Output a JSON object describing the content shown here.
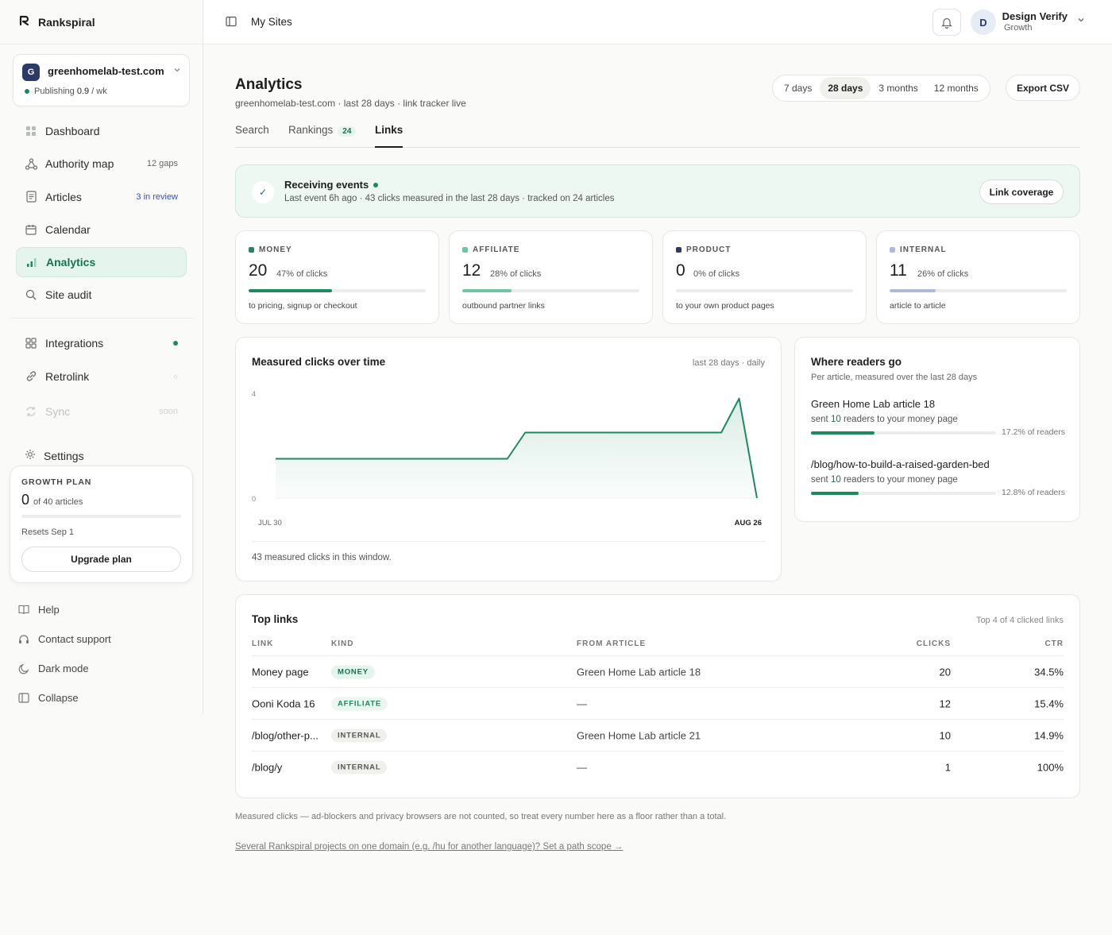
{
  "app": {
    "brand": "Rankspiral"
  },
  "site": {
    "avatar": "G",
    "name": "greenhomelab-test.com",
    "publishing_label": "Publishing",
    "publishing_rate": "0.9",
    "publishing_unit": "/ wk"
  },
  "nav": {
    "dashboard": "Dashboard",
    "authority": "Authority map",
    "authority_meta": "12 gaps",
    "articles": "Articles",
    "articles_meta": "3 in review",
    "calendar": "Calendar",
    "analytics": "Analytics",
    "audit": "Site audit",
    "integrations": "Integrations",
    "retrolink": "Retrolink",
    "retrolink_meta": "○",
    "sync": "Sync",
    "sync_meta": "soon",
    "settings": "Settings"
  },
  "plan": {
    "label": "GROWTH PLAN",
    "count": "0",
    "of": "of 40 articles",
    "used_fraction": 0,
    "resets": "Resets Sep 1",
    "button": "Upgrade plan"
  },
  "footer": {
    "help": "Help",
    "support": "Contact support",
    "dark": "Dark mode",
    "collapse": "Collapse"
  },
  "topbar": {
    "title": "My Sites",
    "user_initial": "D",
    "user_name": "Design Verify",
    "user_plan": "Growth"
  },
  "page": {
    "title": "Analytics",
    "subtitle": "greenhomelab-test.com · last 28 days · link tracker live"
  },
  "ranges": {
    "r7": "7 days",
    "r28": "28 days",
    "r3m": "3 months",
    "r12m": "12 months",
    "export": "Export CSV"
  },
  "tabs": {
    "search": "Search",
    "rankings": "Rankings",
    "rankings_count": "24",
    "links": "Links"
  },
  "events": {
    "title": "Receiving events",
    "subtitle": "Last event 6h ago · 43 clicks measured in the last 28 days · tracked on 24 articles",
    "button": "Link coverage"
  },
  "kpis": [
    {
      "label": "MONEY",
      "value": "20",
      "pct": "47% of clicks",
      "desc": "to pricing, signup or checkout",
      "color": "#1c8a5f",
      "share": 0.47
    },
    {
      "label": "AFFILIATE",
      "value": "12",
      "pct": "28% of clicks",
      "desc": "outbound partner links",
      "color": "#6fc6a3",
      "share": 0.28
    },
    {
      "label": "PRODUCT",
      "value": "0",
      "pct": "0% of clicks",
      "desc": "to your own product pages",
      "color": "#2b3a67",
      "share": 0
    },
    {
      "label": "INTERNAL",
      "value": "11",
      "pct": "26% of clicks",
      "desc": "article to article",
      "color": "#aebbd6",
      "share": 0.26
    }
  ],
  "chart": {
    "title": "Measured clicks over time",
    "meta": "last 28 days · daily",
    "footer": "43 measured clicks in this window."
  },
  "chart_data": {
    "type": "area",
    "title": "Measured clicks over time",
    "x": [
      "JUL 30",
      "",
      "",
      "",
      "",
      "",
      "",
      "",
      "",
      "",
      "",
      "",
      "",
      "",
      "",
      "",
      "",
      "",
      "",
      "",
      "",
      "",
      "",
      "",
      "",
      "",
      "",
      "AUG 26"
    ],
    "x_ticks": [
      "JUL 30",
      "AUG 26"
    ],
    "values": [
      1.5,
      1.5,
      1.5,
      1.5,
      1.5,
      1.5,
      1.5,
      1.5,
      1.5,
      1.5,
      1.5,
      1.5,
      1.5,
      1.5,
      2.5,
      2.5,
      2.5,
      2.5,
      2.5,
      2.5,
      2.5,
      2.5,
      2.5,
      2.5,
      2.5,
      2.5,
      3.8,
      0
    ],
    "ylim": [
      0,
      4
    ],
    "y_ticks": [
      0,
      4
    ],
    "grid": false,
    "color": "#1c8a5f"
  },
  "readers": {
    "title": "Where readers go",
    "subtitle": "Per article, measured over the last 28 days",
    "items": [
      {
        "title": "Green Home Lab article 18",
        "pre": "sent",
        "count": "10",
        "post": "readers to your money page",
        "pct": "17.2% of readers",
        "share": 0.172
      },
      {
        "title": "/blog/how-to-build-a-raised-garden-bed",
        "pre": "sent",
        "count": "10",
        "post": "readers to your money page",
        "pct": "12.8% of readers",
        "share": 0.128
      }
    ]
  },
  "top_links": {
    "title": "Top links",
    "meta": "Top 4 of 4 clicked links",
    "headers": {
      "link": "LINK",
      "kind": "KIND",
      "from": "FROM ARTICLE",
      "clicks": "CLICKS",
      "ctr": "CTR"
    },
    "rows": [
      {
        "link": "Money page",
        "kind": "MONEY",
        "kind_class": "money",
        "from": "Green Home Lab article 18",
        "clicks": "20",
        "ctr": "34.5%"
      },
      {
        "link": "Ooni Koda 16",
        "kind": "AFFILIATE",
        "kind_class": "affiliate",
        "from": "—",
        "clicks": "12",
        "ctr": "15.4%"
      },
      {
        "link": "/blog/other-p...",
        "kind": "INTERNAL",
        "kind_class": "internal",
        "from": "Green Home Lab article 21",
        "clicks": "10",
        "ctr": "14.9%"
      },
      {
        "link": "/blog/y",
        "kind": "INTERNAL",
        "kind_class": "internal",
        "from": "—",
        "clicks": "1",
        "ctr": "100%"
      }
    ]
  },
  "notes": {
    "disclaimer": "Measured clicks — ad-blockers and privacy browsers are not counted, so treat every number here as a floor rather than a total.",
    "scope": "Several Rankspiral projects on one domain (e.g. /hu for another language)? Set a path scope →"
  }
}
